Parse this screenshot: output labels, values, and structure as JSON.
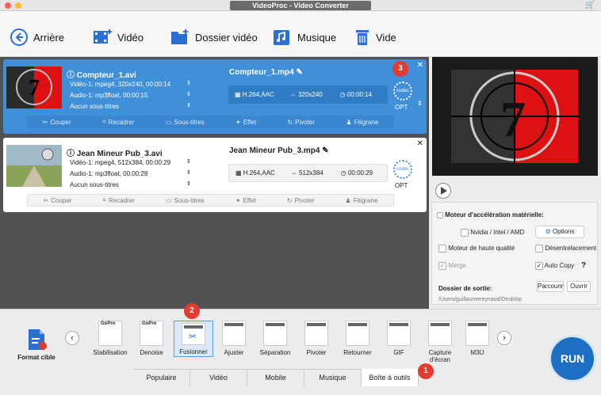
{
  "window": {
    "title": "VideoProc - Video Converter"
  },
  "toolbar": {
    "back": "Arrière",
    "video": "Vidéo",
    "folder": "Dossier vidéo",
    "music": "Musique",
    "clear": "Vide"
  },
  "items": [
    {
      "src_name": "Compteur_1.avi",
      "video_line": "Vidéo-1: mpeg4, 320x240, 00:00:14",
      "audio_line": "Audio-1: mp3float, 00:00:15",
      "subs_line": "Aucun sous-titres",
      "out_name": "Compteur_1.mp4",
      "codec": "H.264,AAC",
      "resolution": "320x240",
      "duration": "00:00:14",
      "codec_badge": "codec",
      "opt": "OPT"
    },
    {
      "src_name": "Jean Mineur Pub_3.avi",
      "video_line": "Vidéo-1: mpeg4, 512x384, 00:00:29",
      "audio_line": "Audio-1: mp3float, 00:00:28",
      "subs_line": "Aucun sous-titres",
      "out_name": "Jean Mineur Pub_3.mp4",
      "codec": "H.264,AAC",
      "resolution": "512x384",
      "duration": "00:00:29",
      "codec_badge": "codec",
      "opt": "OPT"
    }
  ],
  "edit_tools": [
    "Couper",
    "Recadrer",
    "Sous-titres",
    "Effet",
    "Pivoter",
    "Filigrane"
  ],
  "badges": {
    "one": "1",
    "two": "2",
    "three": "3"
  },
  "hw": {
    "title": "Moteur d'accélération matérielle:",
    "nvidia": "Nvidia / Intel / AMD",
    "options": "Options",
    "high_quality": "Moteur de haute qualité",
    "deinterlace": "Désentrelacement",
    "merge": "Merge",
    "autocopy": "Auto Copy",
    "help": "?",
    "output_label": "Dossier de sortie:",
    "browse": "Parcourir",
    "open": "Ouvrir",
    "output_path": "/Users/guillaumereynaud/Desktop"
  },
  "format": {
    "target_label": "Format cible",
    "items": [
      {
        "label": "Stabilisation",
        "brand": "GoPro"
      },
      {
        "label": "Denoise",
        "brand": "GoPro"
      },
      {
        "label": "Fusionner",
        "brand": ""
      },
      {
        "label": "Ajuster",
        "brand": ""
      },
      {
        "label": "Séparation",
        "brand": ""
      },
      {
        "label": "Pivoter",
        "brand": ""
      },
      {
        "label": "Retourner",
        "brand": ""
      },
      {
        "label": "GIF",
        "brand": ""
      },
      {
        "label": "Capture d'écran",
        "brand": ""
      },
      {
        "label": "M3U",
        "brand": ""
      }
    ]
  },
  "tabs": [
    "Populaire",
    "Vidéo",
    "Mobile",
    "Musique",
    "Boîte à outils"
  ],
  "run": "RUN",
  "colors": {
    "accent": "#3f8fd9",
    "badge": "#e23b30",
    "run": "#1d6fc3"
  }
}
